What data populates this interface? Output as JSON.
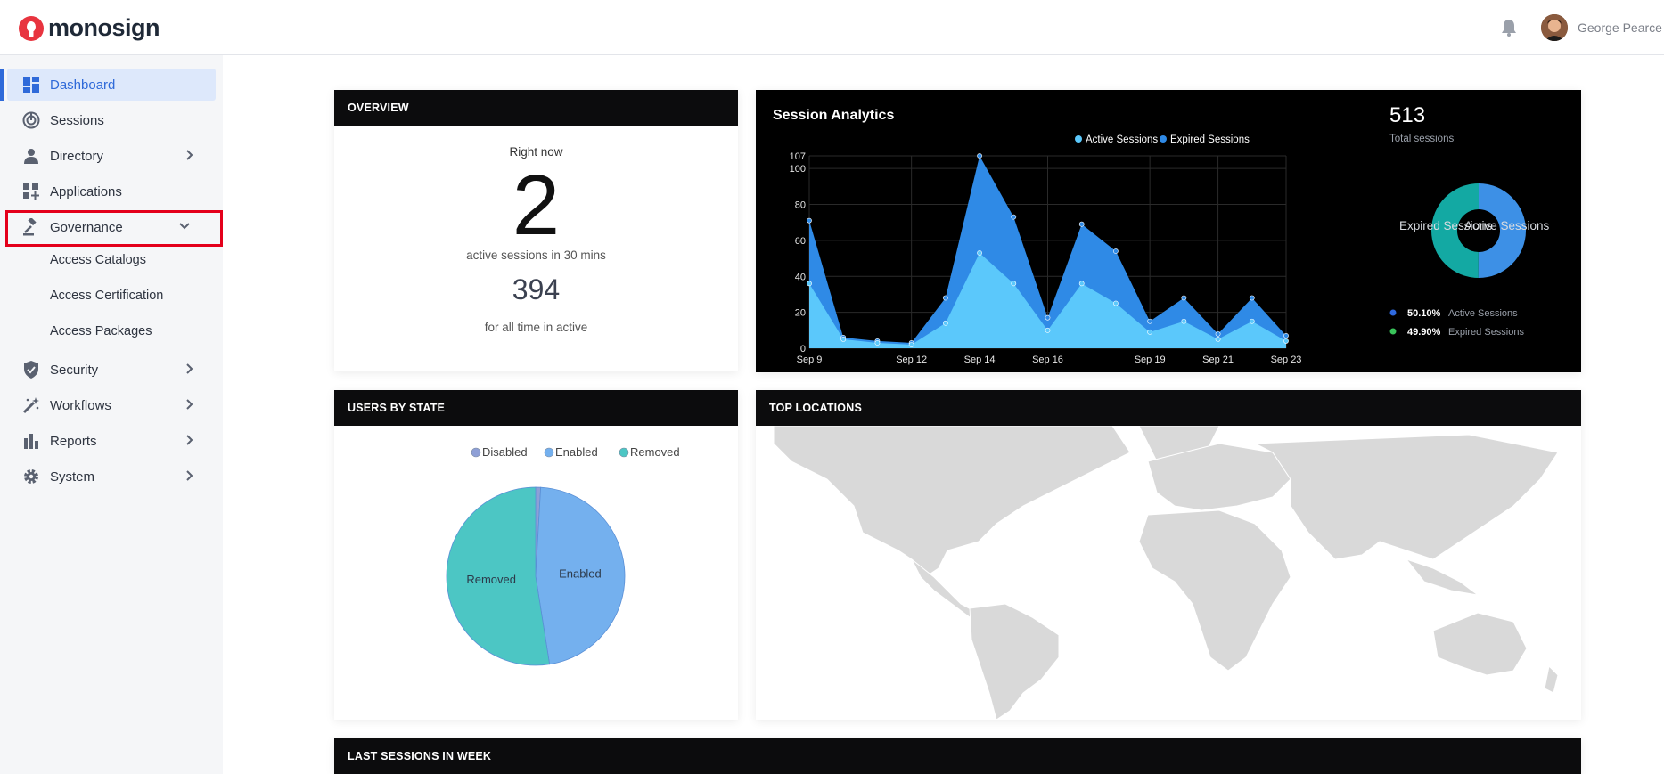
{
  "brand": {
    "name": "monosign",
    "accent": "#e8343f"
  },
  "header": {
    "user_name": "George Pearce",
    "bell_icon": "bell-icon"
  },
  "sidebar": {
    "items": [
      {
        "label": "Dashboard",
        "icon": "dashboard-icon",
        "active": true
      },
      {
        "label": "Sessions",
        "icon": "sessions-icon"
      },
      {
        "label": "Directory",
        "icon": "person-icon",
        "has_children": true
      },
      {
        "label": "Applications",
        "icon": "apps-icon"
      },
      {
        "label": "Governance",
        "icon": "gavel-icon",
        "expanded": true
      },
      {
        "label": "Security",
        "icon": "shield-icon",
        "has_children": true
      },
      {
        "label": "Workflows",
        "icon": "wand-icon",
        "has_children": true
      },
      {
        "label": "Reports",
        "icon": "bar-chart-icon",
        "has_children": true
      },
      {
        "label": "System",
        "icon": "gear-icon",
        "has_children": true
      }
    ],
    "governance_children": [
      "Access Catalogs",
      "Access Certification",
      "Access Packages"
    ]
  },
  "overview": {
    "title": "OVERVIEW",
    "right_now": "Right now",
    "active_count": "2",
    "active_caption": "active sessions in 30 mins",
    "total_count": "394",
    "total_caption": "for all time in active"
  },
  "session_analytics": {
    "title": "Session Analytics",
    "total": "513",
    "total_caption": "Total sessions",
    "donut_label_left": "Expired Sessions",
    "donut_label_right": "Active Sessions",
    "legend": [
      {
        "pct": "50.10%",
        "label": "Active Sessions",
        "color": "#2f6ae0"
      },
      {
        "pct": "49.90%",
        "label": "Expired Sessions",
        "color": "#39c45a"
      }
    ]
  },
  "users_by_state": {
    "title": "USERS BY STATE"
  },
  "top_locations": {
    "title": "TOP LOCATIONS"
  },
  "last_sessions": {
    "title": "LAST SESSIONS IN WEEK"
  },
  "chart_data": [
    {
      "type": "area",
      "legend": [
        "Active Sessions",
        "Expired Sessions"
      ],
      "x": [
        "Sep 9",
        "Sep 10",
        "Sep 11",
        "Sep 12",
        "Sep 13",
        "Sep 14",
        "Sep 15",
        "Sep 16",
        "Sep 17",
        "Sep 18",
        "Sep 19",
        "Sep 20",
        "Sep 21",
        "Sep 22",
        "Sep 23"
      ],
      "x_tick_labels": [
        "Sep 9",
        "Sep 12",
        "Sep 14",
        "Sep 16",
        "Sep 19",
        "Sep 21",
        "Sep 23"
      ],
      "y_ticks": [
        0,
        20,
        40,
        60,
        80,
        100,
        107
      ],
      "ylim": [
        0,
        107
      ],
      "series": [
        {
          "name": "Active Sessions",
          "color": "#5bc8fb",
          "values": [
            36,
            5,
            3,
            2,
            14,
            53,
            36,
            10,
            36,
            25,
            9,
            15,
            5,
            15,
            4
          ]
        },
        {
          "name": "Expired Sessions",
          "color": "#2f8ae6",
          "values": [
            71,
            6,
            4,
            3,
            28,
            107,
            73,
            17,
            69,
            54,
            15,
            28,
            8,
            28,
            7
          ]
        }
      ]
    },
    {
      "type": "pie",
      "categories": [
        "Active Sessions",
        "Expired Sessions"
      ],
      "values": [
        50.1,
        49.9
      ],
      "colors": [
        "#3d90e6",
        "#13a9a3"
      ]
    },
    {
      "type": "pie",
      "legend": [
        "Disabled",
        "Enabled",
        "Removed"
      ],
      "categories": [
        "Disabled",
        "Enabled",
        "Removed"
      ],
      "values": [
        0.9,
        46.6,
        52.5
      ],
      "slice_labels": [
        "",
        "Enabled",
        "Removed"
      ],
      "colors": [
        "#8e9fd6",
        "#74b0ee",
        "#4cc6c4"
      ]
    }
  ]
}
